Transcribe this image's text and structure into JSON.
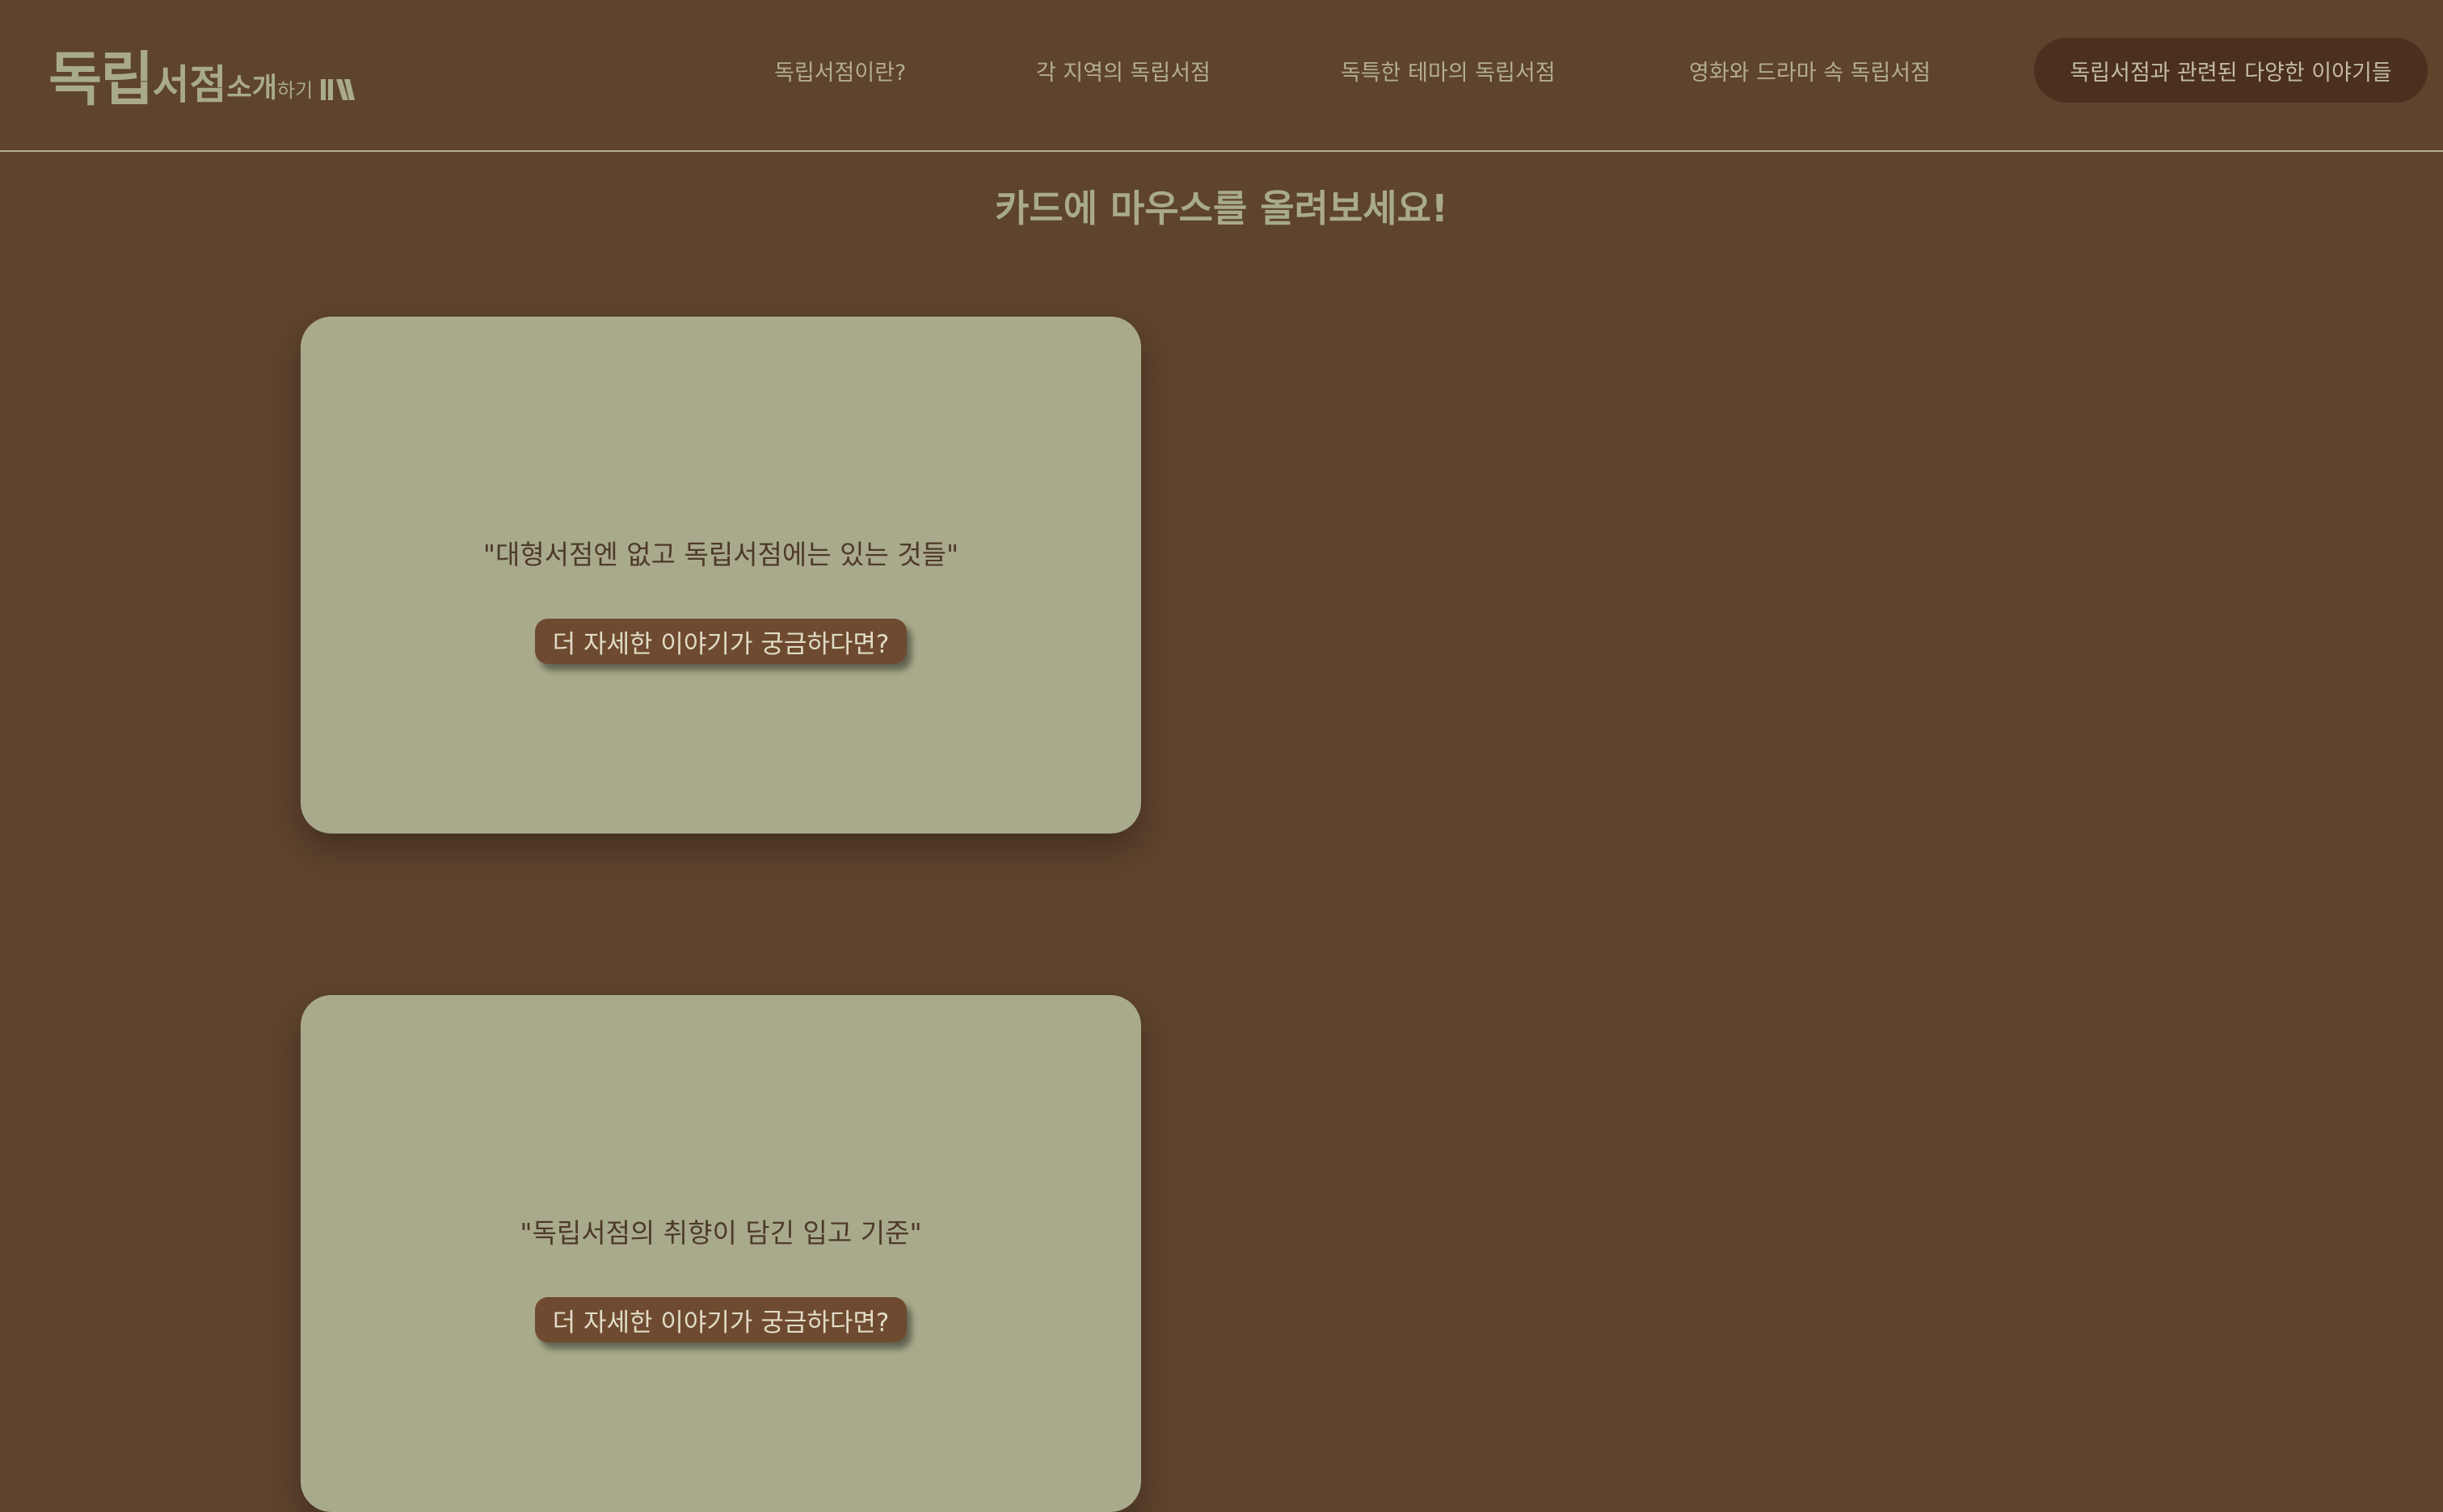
{
  "header": {
    "logo": {
      "part1": "독립",
      "part2": "서점",
      "part3": "소개",
      "part4": "하기",
      "mark_icon": "book-stack-icon"
    },
    "nav": [
      {
        "label": "독립서점이란?"
      },
      {
        "label": "각 지역의 독립서점"
      },
      {
        "label": "독특한 테마의 독립서점"
      },
      {
        "label": "영화와 드라마 속 독립서점"
      },
      {
        "label": "독립서점과 관련된 다양한 이야기들"
      }
    ]
  },
  "main": {
    "hint": "카드에 마우스를 올려보세요!",
    "cards": [
      {
        "quote": "\"대형서점엔 없고 독립서점에는 있는 것들\"",
        "button": "더 자세한 이야기가 궁금하다면?"
      },
      {
        "quote": "\"독립서점의 취향이 담긴 입고 기준\"",
        "button": "더 자세한 이야기가 궁금하다면?"
      }
    ]
  },
  "colors": {
    "background": "#5e432d",
    "card": "#a8aa8b",
    "pill": "#4b2f1f",
    "button": "#6e4a30",
    "text_light": "#b3ad8e"
  }
}
